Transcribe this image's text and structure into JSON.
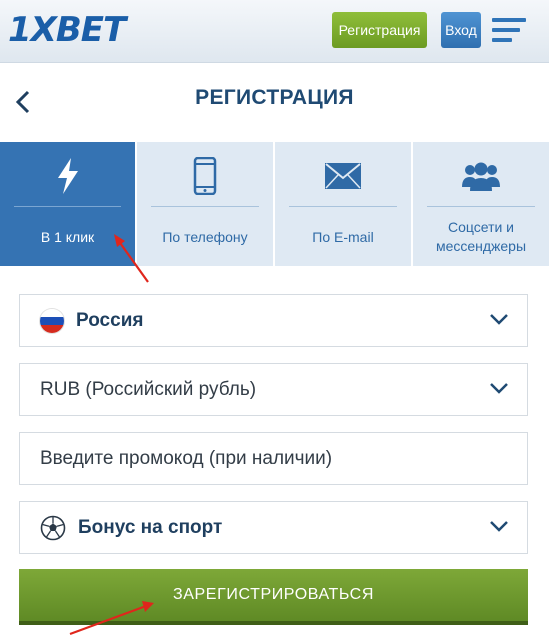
{
  "header": {
    "logo": "1XBET",
    "register_label": "Регистрация",
    "login_label": "Вход",
    "menu_icon": "hamburger-menu-icon"
  },
  "title_bar": {
    "back_icon": "chevron-left-icon",
    "title": "РЕГИСТРАЦИЯ"
  },
  "tabs": [
    {
      "label": "В 1 клик",
      "icon": "lightning-icon",
      "active": true
    },
    {
      "label": "По телефону",
      "icon": "smartphone-icon",
      "active": false
    },
    {
      "label": "По E-mail",
      "icon": "envelope-icon",
      "active": false
    },
    {
      "label": "Соцсети и мессенджеры",
      "icon": "users-icon",
      "active": false
    }
  ],
  "form": {
    "country": {
      "value": "Россия",
      "icon": "russia-flag-icon"
    },
    "currency": {
      "value": "RUB (Российский рубль)"
    },
    "promo": {
      "placeholder": "Введите промокод (при наличии)"
    },
    "bonus": {
      "value": "Бонус на спорт",
      "icon": "soccer-ball-icon"
    },
    "submit_label": "ЗАРЕГИСТРИРОВАТЬСЯ"
  },
  "colors": {
    "brand_blue": "#1a5ea8",
    "tab_active": "#3573b3",
    "tab_inactive": "#dfe9f3",
    "submit_green": "#6c9b22",
    "annotation_arrow": "#e0261c"
  }
}
